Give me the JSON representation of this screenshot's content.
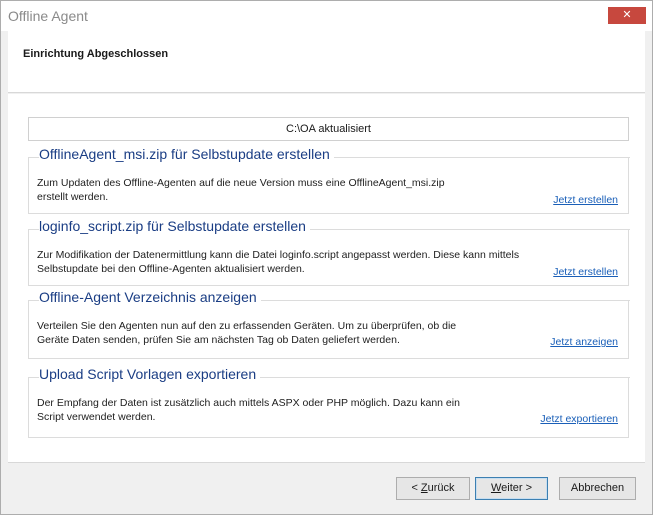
{
  "window": {
    "title": "Offline Agent",
    "close_label": "✕"
  },
  "header": {
    "title": "Einrichtung Abgeschlossen"
  },
  "status": {
    "text": "C:\\OA aktualisiert"
  },
  "groups": [
    {
      "title": "OfflineAgent_msi.zip für Selbstupdate erstellen",
      "desc_line1": "Zum Updaten des Offline-Agenten auf die neue Version muss eine OfflineAgent_msi.zip",
      "desc_line2": "erstellt werden.",
      "link": "Jetzt erstellen"
    },
    {
      "title": "loginfo_script.zip für Selbstupdate erstellen",
      "desc_line1": "Zur Modifikation der Datenermittlung kann die Datei loginfo.script angepasst werden. Diese kann mittels",
      "desc_line2": "Selbstupdate bei den Offline-Agenten aktualisiert werden.",
      "link": "Jetzt erstellen"
    },
    {
      "title": "Offline-Agent Verzeichnis anzeigen",
      "desc_line1": "Verteilen Sie den Agenten nun auf den zu erfassenden Geräten. Um zu überprüfen, ob die",
      "desc_line2": "Geräte Daten senden, prüfen Sie am nächsten Tag ob Daten geliefert werden.",
      "link": "Jetzt anzeigen"
    },
    {
      "title": "Upload Script Vorlagen exportieren",
      "desc_line1": "Der Empfang der Daten ist zusätzlich auch mittels ASPX oder PHP möglich. Dazu kann ein",
      "desc_line2": "Script verwendet werden.",
      "link": "Jetzt exportieren"
    }
  ],
  "buttons": {
    "back_pre": "< ",
    "back_key": "Z",
    "back_post": "urück",
    "next_key": "W",
    "next_post": "eiter >",
    "cancel": "Abbrechen"
  }
}
